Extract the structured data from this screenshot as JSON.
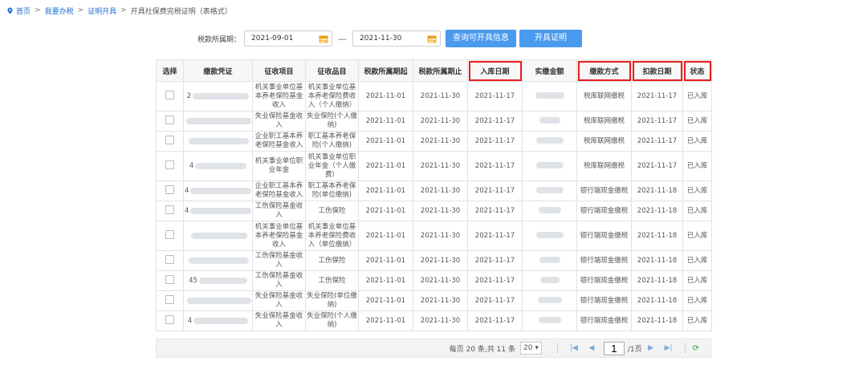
{
  "breadcrumb": {
    "home": "首页",
    "item1": "我要办税",
    "item2": "证明开具",
    "current": "开具社保费完税证明（表格式）",
    "sep": ">"
  },
  "filter": {
    "label": "税款所属期：",
    "start": "2021-09-01",
    "dash": "—",
    "end": "2021-11-30",
    "query_button": "查询可开具信息",
    "issue_button": "开具证明"
  },
  "table": {
    "headers": [
      "选择",
      "缴款凭证",
      "征收项目",
      "征收品目",
      "税款所属期起",
      "税款所属期止",
      "入库日期",
      "实缴金额",
      "缴款方式",
      "扣款日期",
      "状态"
    ],
    "rows": [
      {
        "voucher": "2",
        "project": "机关事业单位基本养老保险基金收入",
        "item": "机关事业单位基本养老保险费收入（个人缴纳）",
        "start": "2021-11-01",
        "end": "2021-11-30",
        "in_date": "2021-11-17",
        "method": "税库联网缴税",
        "deduct": "2021-11-17",
        "status": "已入库"
      },
      {
        "voucher": "",
        "project": "失业保险基金收入",
        "item": "失业保险(个人缴纳)",
        "start": "2021-11-01",
        "end": "2021-11-30",
        "in_date": "2021-11-17",
        "method": "税库联网缴税",
        "deduct": "2021-11-17",
        "status": "已入库"
      },
      {
        "voucher": "",
        "project": "企业职工基本养老保险基金收入",
        "item": "职工基本养老保险(个人缴纳)",
        "start": "2021-11-01",
        "end": "2021-11-30",
        "in_date": "2021-11-17",
        "method": "税库联网缴税",
        "deduct": "2021-11-17",
        "status": "已入库"
      },
      {
        "voucher": "4",
        "project": "机关事业单位职业年金",
        "item": "机关事业单位职业年金（个人缴费）",
        "start": "2021-11-01",
        "end": "2021-11-30",
        "in_date": "2021-11-17",
        "method": "税库联网缴税",
        "deduct": "2021-11-17",
        "status": "已入库"
      },
      {
        "voucher": "4",
        "project": "企业职工基本养老保险基金收入",
        "item": "职工基本养老保险(单位缴纳)",
        "start": "2021-11-01",
        "end": "2021-11-30",
        "in_date": "2021-11-17",
        "method": "银行端现金缴税",
        "deduct": "2021-11-18",
        "status": "已入库"
      },
      {
        "voucher": "4",
        "project": "工伤保险基金收入",
        "item": "工伤保险",
        "start": "2021-11-01",
        "end": "2021-11-30",
        "in_date": "2021-11-17",
        "method": "银行端现金缴税",
        "deduct": "2021-11-18",
        "status": "已入库"
      },
      {
        "voucher": "",
        "project": "机关事业单位基本养老保险基金收入",
        "item": "机关事业单位基本养老保险费收入（单位缴纳）",
        "start": "2021-11-01",
        "end": "2021-11-30",
        "in_date": "2021-11-17",
        "method": "银行端现金缴税",
        "deduct": "2021-11-18",
        "status": "已入库"
      },
      {
        "voucher": "",
        "project": "工伤保险基金收入",
        "item": "工伤保险",
        "start": "2021-11-01",
        "end": "2021-11-30",
        "in_date": "2021-11-17",
        "method": "银行端现金缴税",
        "deduct": "2021-11-18",
        "status": "已入库"
      },
      {
        "voucher": "45",
        "project": "工伤保险基金收入",
        "item": "工伤保险",
        "start": "2021-11-01",
        "end": "2021-11-30",
        "in_date": "2021-11-17",
        "method": "银行端现金缴税",
        "deduct": "2021-11-18",
        "status": "已入库"
      },
      {
        "voucher": "",
        "project": "失业保险基金收入",
        "item": "失业保险(单位缴纳)",
        "start": "2021-11-01",
        "end": "2021-11-30",
        "in_date": "2021-11-17",
        "method": "银行端现金缴税",
        "deduct": "2021-11-18",
        "status": "已入库"
      },
      {
        "voucher": "4",
        "project": "失业保险基金收入",
        "item": "失业保险(个人缴纳)",
        "start": "2021-11-01",
        "end": "2021-11-30",
        "in_date": "2021-11-17",
        "method": "银行端现金缴税",
        "deduct": "2021-11-18",
        "status": "已入库"
      }
    ]
  },
  "pager": {
    "summary": "每页 20 条,共 11 条",
    "per_page": "20",
    "page": "1",
    "total_pages": "/1页"
  },
  "colors": {
    "accent": "#4a9bf0",
    "link": "#1e6fd6",
    "highlight": "#e81e1e"
  },
  "icons": {
    "home": "location-pin-icon",
    "calendar": "calendar-icon",
    "first": "first-page-icon",
    "prev": "prev-page-icon",
    "next": "next-page-icon",
    "last": "last-page-icon",
    "refresh": "refresh-icon"
  }
}
